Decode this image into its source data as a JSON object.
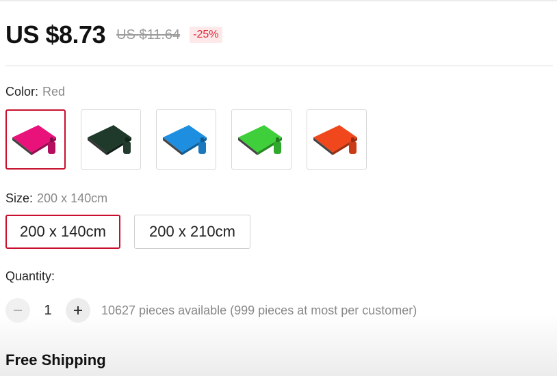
{
  "price": {
    "current": "US $8.73",
    "original": "US $11.64",
    "discount": "-25%"
  },
  "color": {
    "label": "Color:",
    "selected": "Red",
    "options": [
      {
        "name": "magenta",
        "color": "#e8127a",
        "selected": true
      },
      {
        "name": "dark-green",
        "color": "#1f3a2b",
        "selected": false
      },
      {
        "name": "blue",
        "color": "#1e8fe0",
        "selected": false
      },
      {
        "name": "green",
        "color": "#3fcf3a",
        "selected": false
      },
      {
        "name": "orange",
        "color": "#f0481c",
        "selected": false
      }
    ]
  },
  "size": {
    "label": "Size:",
    "selected": "200 x 140cm",
    "options": [
      "200 x 140cm",
      "200 x 210cm"
    ]
  },
  "quantity": {
    "label": "Quantity:",
    "value": "1",
    "available": "10627 pieces available (999 pieces at most per customer)",
    "minus_icon": "minus-icon",
    "plus_icon": "plus-icon"
  },
  "shipping": {
    "label": "Free Shipping"
  },
  "colors": {
    "accent": "#c8102e",
    "discount_text": "#e02b3a",
    "discount_bg": "#fde8ea"
  }
}
